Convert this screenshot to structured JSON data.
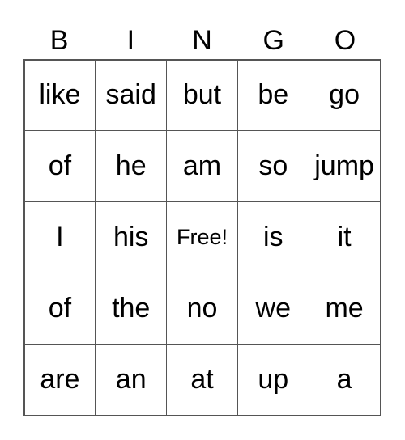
{
  "header": [
    "B",
    "I",
    "N",
    "G",
    "O"
  ],
  "cells": [
    [
      "like",
      "said",
      "but",
      "be",
      "go"
    ],
    [
      "of",
      "he",
      "am",
      "so",
      "jump"
    ],
    [
      "I",
      "his",
      "Free!",
      "is",
      "it"
    ],
    [
      "of",
      "the",
      "no",
      "we",
      "me"
    ],
    [
      "are",
      "an",
      "at",
      "up",
      "a"
    ]
  ]
}
